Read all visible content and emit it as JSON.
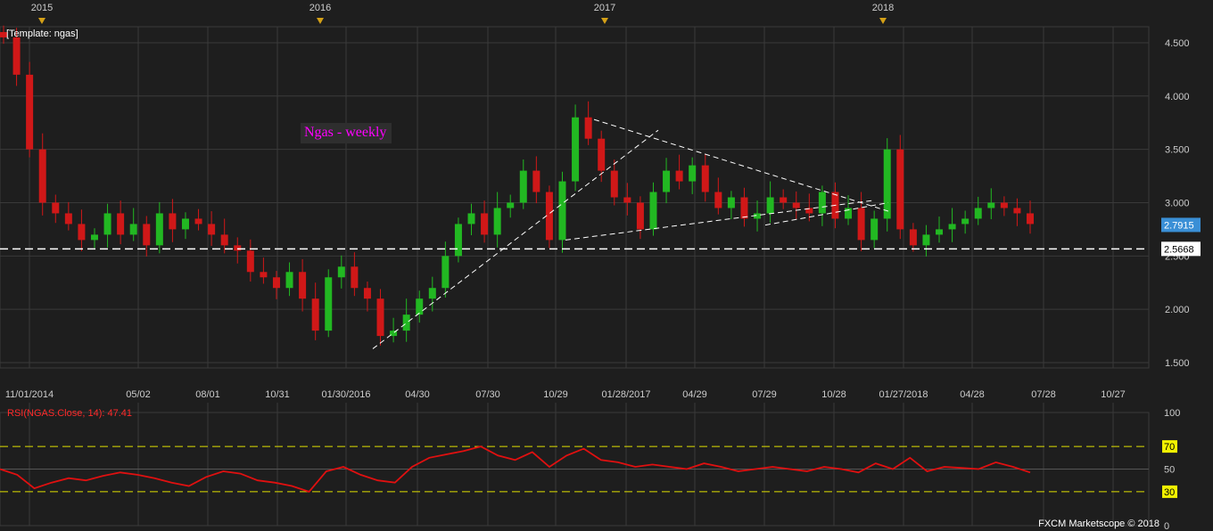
{
  "chart_data": [
    {
      "type": "candlestick",
      "template_label": "[Template: ngas]",
      "title": "Ngas - weekly",
      "year_markers": [
        "2015",
        "2016",
        "2017",
        "2018"
      ],
      "x_tick_labels": [
        "11/01/2014",
        "05/02",
        "08/01",
        "10/31",
        "01/30/2016",
        "04/30",
        "07/30",
        "10/29",
        "01/28/2017",
        "04/29",
        "07/29",
        "10/28",
        "01/27/2018",
        "04/28",
        "07/28",
        "10/27"
      ],
      "y_tick_labels": [
        "4.500",
        "4.000",
        "3.500",
        "3.000",
        "2.500",
        "2.000",
        "1.500"
      ],
      "ylim": [
        1.45,
        4.65
      ],
      "current_price": "2.7915",
      "support_level": "2.5668",
      "grid": true,
      "colors": {
        "up": "#22b822",
        "down": "#d01818",
        "background": "#1e1e1e",
        "grid": "#3a3a3a",
        "current_price_tag": "#3a8fd6"
      },
      "close_series_approx": [
        4.55,
        4.2,
        3.5,
        3.0,
        2.9,
        2.8,
        2.65,
        2.7,
        2.9,
        2.7,
        2.8,
        2.6,
        2.9,
        2.75,
        2.85,
        2.8,
        2.7,
        2.6,
        2.55,
        2.35,
        2.3,
        2.2,
        2.35,
        2.1,
        1.8,
        2.3,
        2.4,
        2.2,
        2.1,
        1.75,
        1.8,
        1.95,
        2.1,
        2.2,
        2.5,
        2.8,
        2.9,
        2.7,
        2.95,
        3.0,
        3.3,
        3.1,
        2.65,
        3.2,
        3.8,
        3.6,
        3.3,
        3.05,
        3.0,
        2.75,
        3.1,
        3.3,
        3.2,
        3.35,
        3.1,
        2.95,
        3.05,
        2.85,
        2.9,
        3.05,
        3.0,
        2.95,
        2.9,
        3.1,
        2.85,
        2.95,
        2.65,
        2.85,
        3.5,
        2.75,
        2.6,
        2.7,
        2.75,
        2.8,
        2.85,
        2.95,
        3.0,
        2.95,
        2.9,
        2.8
      ]
    },
    {
      "type": "line",
      "label": "RSI(NGAS.Close, 14): 47.41",
      "y_tick_labels": [
        "100",
        "70",
        "50",
        "30",
        "0"
      ],
      "ylim": [
        0,
        100
      ],
      "reference_levels": [
        70,
        30
      ],
      "color": "#e01010",
      "values_approx": [
        50,
        45,
        33,
        38,
        42,
        40,
        44,
        47,
        45,
        42,
        38,
        35,
        43,
        48,
        46,
        40,
        38,
        35,
        30,
        48,
        52,
        45,
        40,
        38,
        52,
        60,
        63,
        66,
        70,
        62,
        58,
        65,
        52,
        62,
        68,
        58,
        56,
        52,
        54,
        52,
        50,
        55,
        52,
        48,
        50,
        52,
        50,
        48,
        52,
        50,
        47,
        55,
        50,
        60,
        48,
        52,
        51,
        50,
        56,
        52,
        47
      ]
    }
  ],
  "watermark": "FXCM Marketscope © 2018"
}
